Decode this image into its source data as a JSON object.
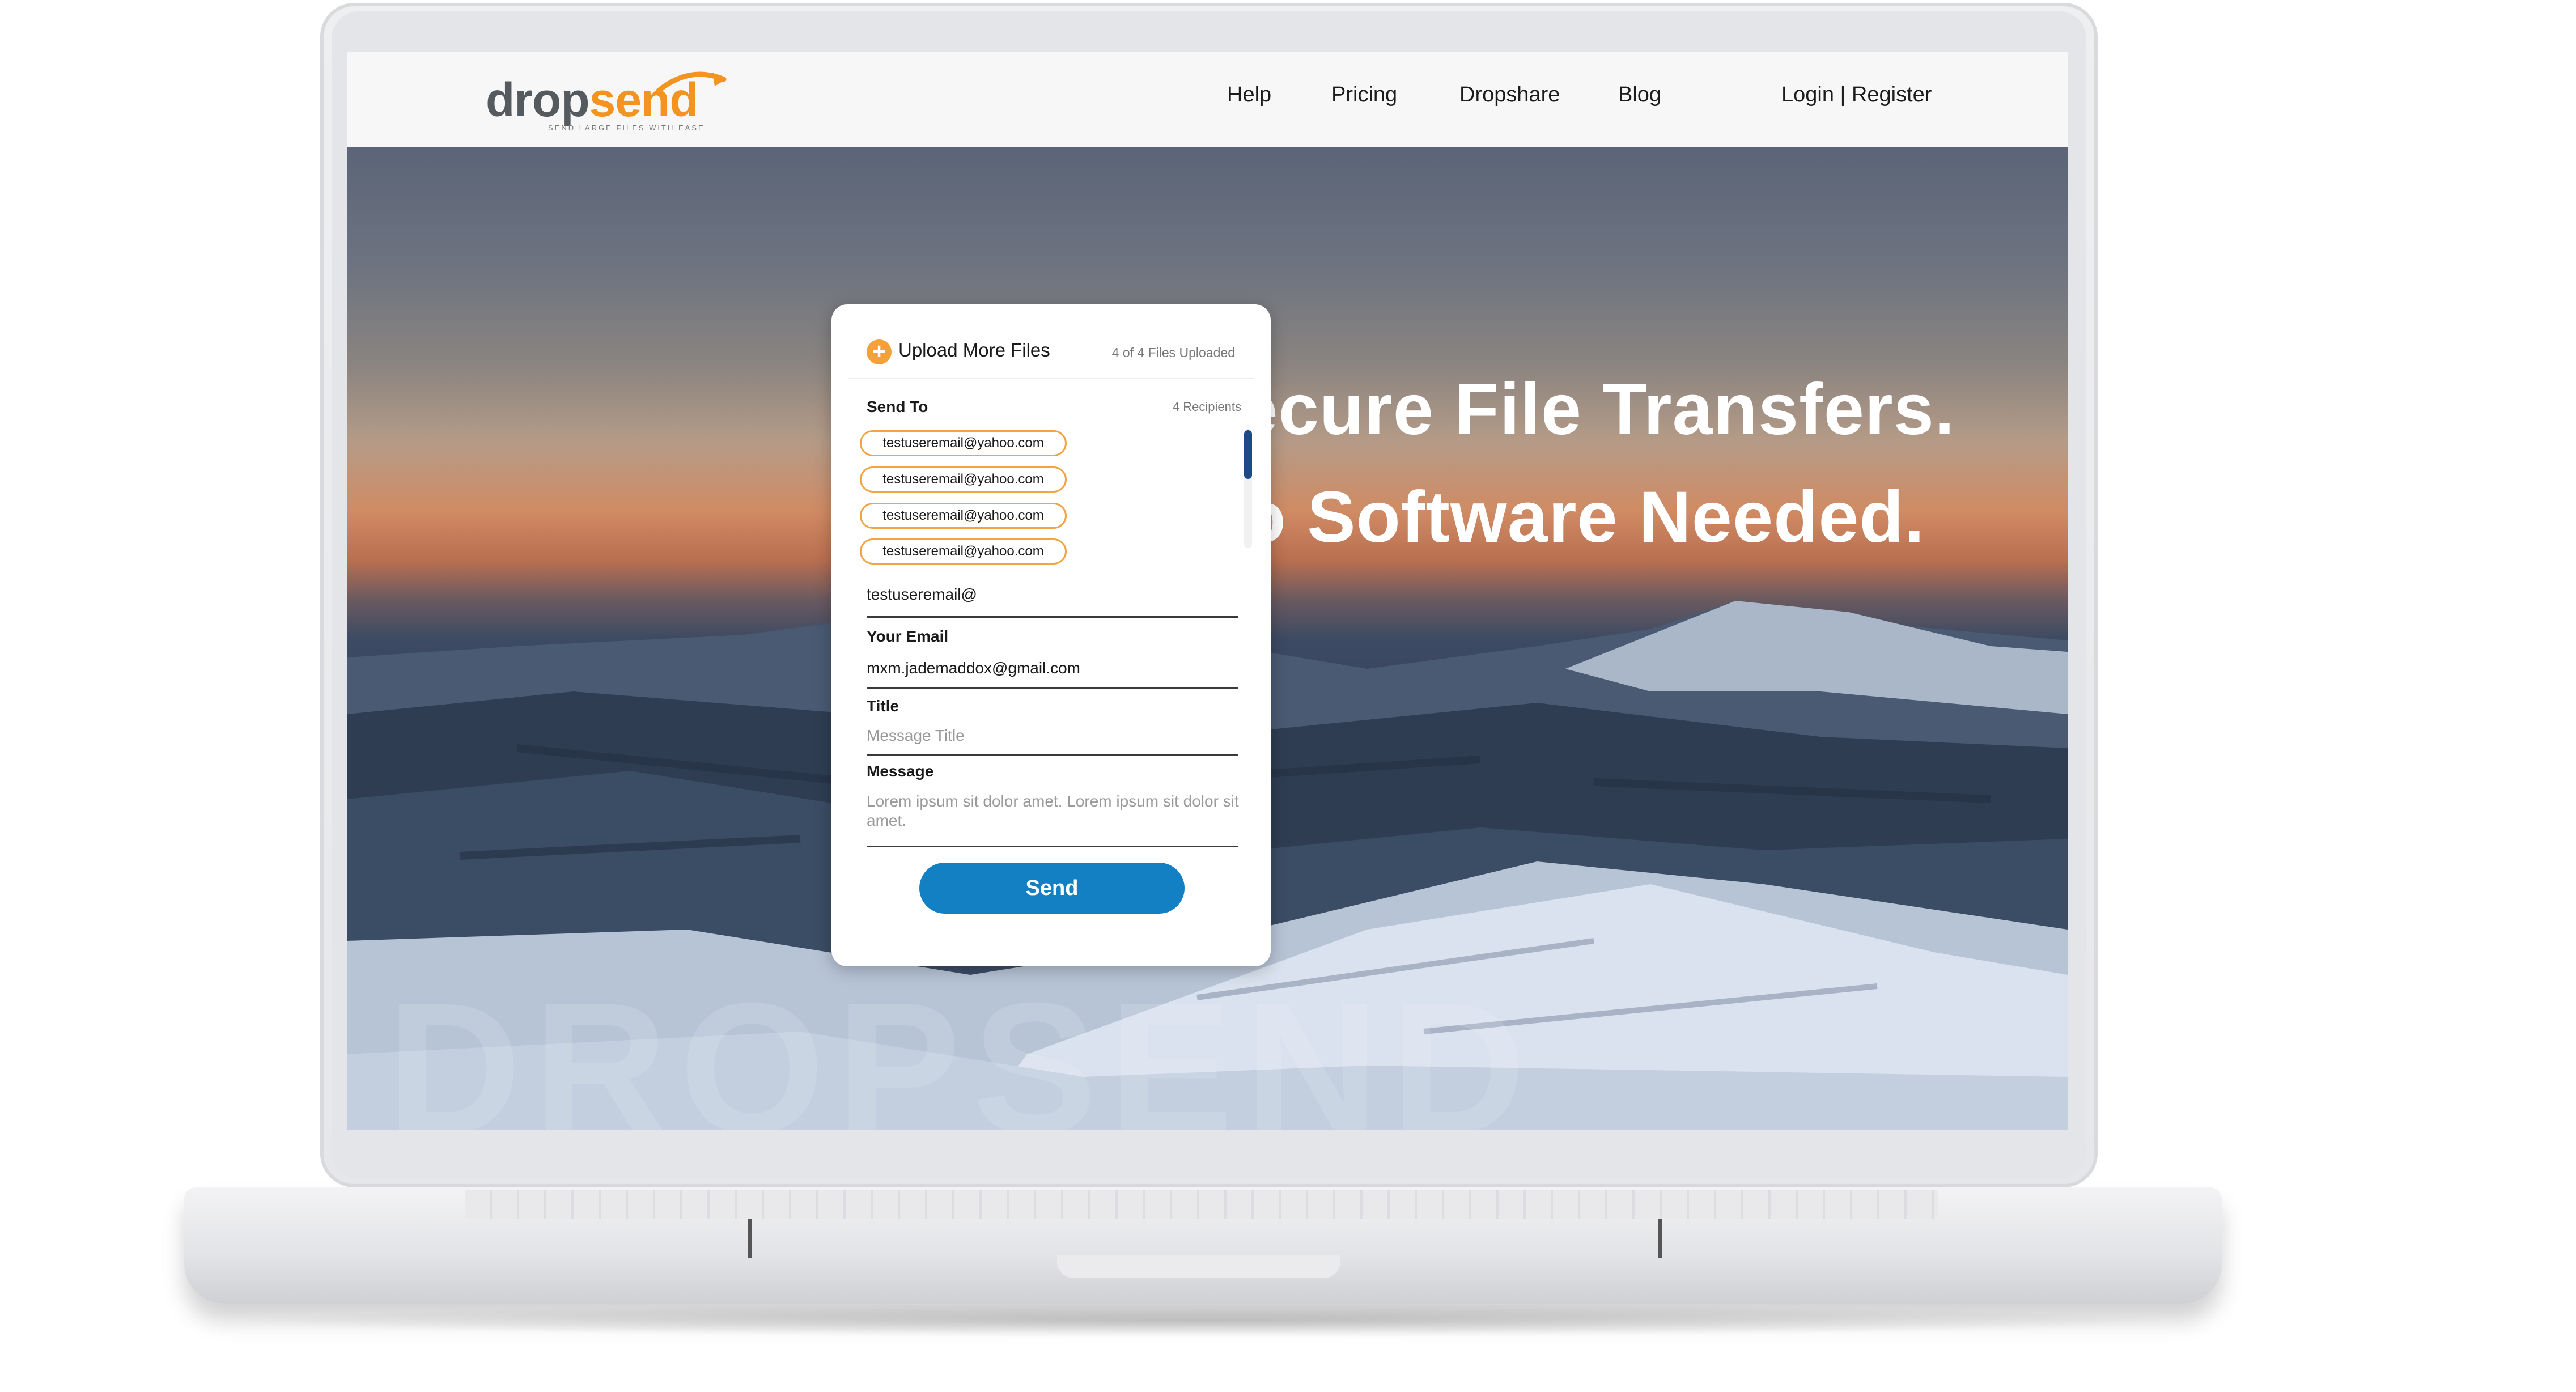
{
  "brand": {
    "word_part1": "drop",
    "word_part2": "send",
    "tagline": "SEND LARGE FILES WITH EASE",
    "accent_color": "#f2941f",
    "button_color": "#1380c4"
  },
  "nav": {
    "links": [
      "Help",
      "Pricing",
      "Dropshare",
      "Blog"
    ],
    "account": "Login | Register"
  },
  "hero": {
    "headline_line1": "Secure File Transfers.",
    "headline_line2": "No Software Needed.",
    "watermark": "DROPSEND"
  },
  "upload_card": {
    "upload_label": "Upload More Files",
    "files_status": "4 of 4 Files Uploaded",
    "send_to_label": "Send To",
    "recipients_count": "4 Recipients",
    "recipients": [
      "testuseremail@yahoo.com",
      "testuseremail@yahoo.com",
      "testuseremail@yahoo.com",
      "testuseremail@yahoo.com"
    ],
    "recipient_input_value": "testuseremail@",
    "your_email_label": "Your Email",
    "your_email_value": "mxm.jademaddox@gmail.com",
    "title_label": "Title",
    "title_placeholder": "Message Title",
    "message_label": "Message",
    "message_placeholder": "Lorem ipsum sit dolor amet. Lorem ipsum sit dolor sit amet.",
    "send_label": "Send"
  }
}
